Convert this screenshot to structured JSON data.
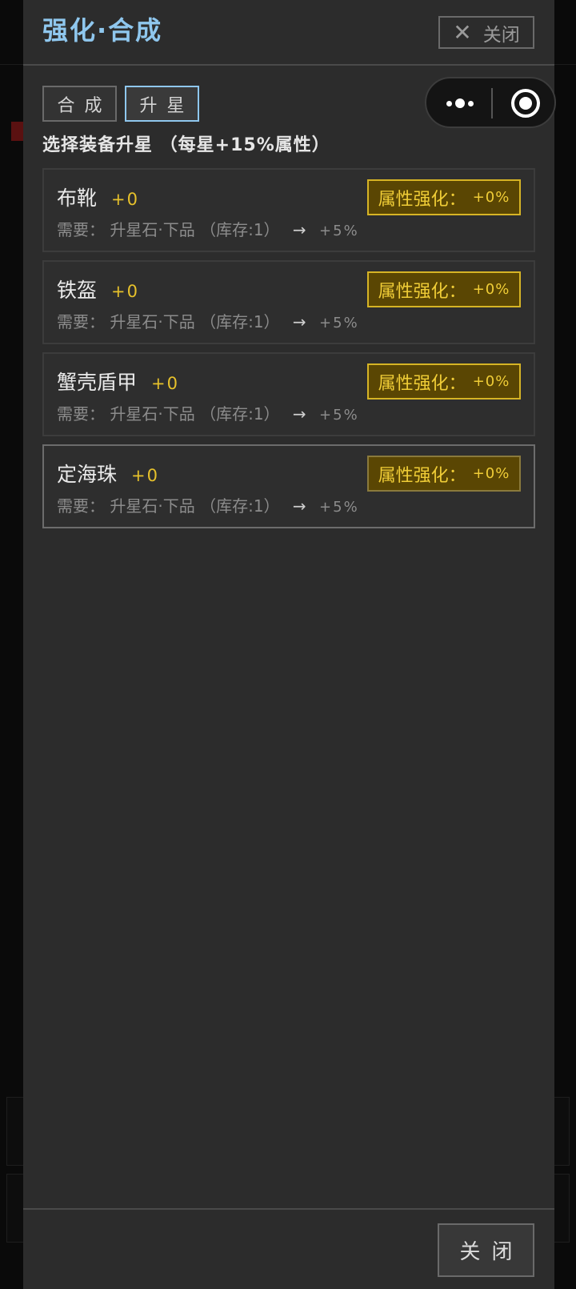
{
  "modal": {
    "title": "强化·合成",
    "close_top_icon": "close-icon",
    "close_top_label": "关闭",
    "tabs": [
      {
        "label": "合成",
        "active": false
      },
      {
        "label": "升星",
        "active": true
      }
    ],
    "section_title": "选择装备升星 （每星+15%属性）",
    "items": [
      {
        "name": "布靴",
        "level": "+0",
        "req_label": "需要：",
        "req_item": "升星石·下品",
        "stock": "（库存:1）",
        "arrow": "→",
        "bonus": "+5%",
        "attr_label": "属性强化：",
        "attr_value": "+0%"
      },
      {
        "name": "铁盔",
        "level": "+0",
        "req_label": "需要：",
        "req_item": "升星石·下品",
        "stock": "（库存:1）",
        "arrow": "→",
        "bonus": "+5%",
        "attr_label": "属性强化：",
        "attr_value": "+0%"
      },
      {
        "name": "蟹壳盾甲",
        "level": "+0",
        "req_label": "需要：",
        "req_item": "升星石·下品",
        "stock": "（库存:1）",
        "arrow": "→",
        "bonus": "+5%",
        "attr_label": "属性强化：",
        "attr_value": "+0%"
      },
      {
        "name": "定海珠",
        "level": "+0",
        "req_label": "需要：",
        "req_item": "升星石·下品",
        "stock": "（库存:1）",
        "arrow": "→",
        "bonus": "+5%",
        "attr_label": "属性强化：",
        "attr_value": "+0%"
      }
    ],
    "close_bottom_label": "关闭"
  },
  "capsule": {
    "more_icon": "more-dots-icon",
    "target_icon": "target-icon"
  },
  "colors": {
    "accent_title": "#8fc7ee",
    "gold": "#e6c12b",
    "panel_bg": "#2c2c2c"
  }
}
